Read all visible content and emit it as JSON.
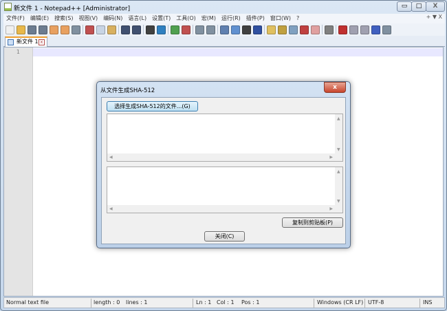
{
  "window": {
    "title": "新文件 1 - Notepad++ [Administrator]",
    "minimize": "▭",
    "maximize": "□",
    "close": "X"
  },
  "menu": {
    "items": [
      "文件(F)",
      "编辑(E)",
      "搜索(S)",
      "视图(V)",
      "编码(N)",
      "语言(L)",
      "设置(T)",
      "工具(O)",
      "宏(M)",
      "运行(R)",
      "插件(P)",
      "窗口(W)",
      "?"
    ],
    "right": "+ ▼ X"
  },
  "toolbar": {
    "icons": [
      {
        "name": "new-file-icon",
        "color": "#f0f0f0"
      },
      {
        "name": "open-file-icon",
        "color": "#e8b84a"
      },
      {
        "name": "save-icon",
        "color": "#6c7c90"
      },
      {
        "name": "save-all-icon",
        "color": "#6c7c90"
      },
      {
        "name": "close-icon",
        "color": "#e8a060"
      },
      {
        "name": "close-all-icon",
        "color": "#e8a060"
      },
      {
        "name": "print-icon",
        "color": "#8090a0"
      },
      "sep",
      {
        "name": "cut-icon",
        "color": "#c05050"
      },
      {
        "name": "copy-icon",
        "color": "#c8d4e4"
      },
      {
        "name": "paste-icon",
        "color": "#d8b060"
      },
      "sep",
      {
        "name": "undo-icon",
        "color": "#405070"
      },
      {
        "name": "redo-icon",
        "color": "#405070"
      },
      "sep",
      {
        "name": "find-icon",
        "color": "#404040"
      },
      {
        "name": "replace-icon",
        "color": "#3080c0"
      },
      "sep",
      {
        "name": "zoom-in-icon",
        "color": "#50a050"
      },
      {
        "name": "zoom-out-icon",
        "color": "#c05050"
      },
      "sep",
      {
        "name": "sync-vertical-icon",
        "color": "#8090a0"
      },
      {
        "name": "sync-horizontal-icon",
        "color": "#8090a0"
      },
      "sep",
      {
        "name": "word-wrap-icon",
        "color": "#6080b0"
      },
      {
        "name": "show-all-chars-icon",
        "color": "#6090d0"
      },
      {
        "name": "dropdown-icon",
        "color": "#404040"
      },
      {
        "name": "indent-guide-icon",
        "color": "#3050a0"
      },
      "sep",
      {
        "name": "user-lang-icon",
        "color": "#e0c060"
      },
      {
        "name": "doc-map-icon",
        "color": "#c0a040"
      },
      {
        "name": "function-list-icon",
        "color": "#80a0c0"
      },
      {
        "name": "folder-workspace-icon",
        "color": "#c04040"
      },
      {
        "name": "monitor-icon",
        "color": "#e0a0a0"
      },
      "sep",
      {
        "name": "record-icon",
        "color": "#808080"
      },
      "sep",
      {
        "name": "start-record-icon",
        "color": "#c03030"
      },
      {
        "name": "stop-record-icon",
        "color": "#a0a0b0"
      },
      {
        "name": "play-macro-icon",
        "color": "#a0a0b0"
      },
      {
        "name": "run-macro-multiple-icon",
        "color": "#4060c0"
      },
      {
        "name": "save-macro-icon",
        "color": "#8090a0"
      }
    ]
  },
  "tab": {
    "label": "新文件 1",
    "close": "x"
  },
  "editor": {
    "line_number": "1"
  },
  "status": {
    "type": "Normal text file",
    "length": "length : 0",
    "lines": "lines : 1",
    "ln": "Ln : 1",
    "col": "Col : 1",
    "pos": "Pos : 1",
    "eol": "Windows (CR LF)",
    "encoding": "UTF-8",
    "mode": "INS"
  },
  "dialog": {
    "title": "从文件生成SHA-512",
    "close": "x",
    "choose_button": "选择生成SHA-512的文件...(G)",
    "copy_button": "复制到剪贴板(P)",
    "close_button": "关闭(C)",
    "files_text": "",
    "hash_text": ""
  }
}
